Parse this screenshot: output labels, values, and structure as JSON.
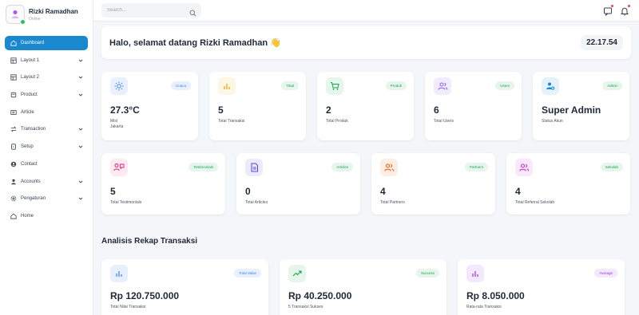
{
  "profile": {
    "name": "Rizki Ramadhan",
    "role": "Online",
    "avatar_icon": "user-logo-icon",
    "status_color": "#22c55e"
  },
  "sidebar": {
    "items": [
      {
        "label": "Dashboard",
        "icon": "home-icon",
        "active": true,
        "chevron": false
      },
      {
        "label": "Layout 1",
        "icon": "layout-icon",
        "active": false,
        "chevron": true
      },
      {
        "label": "Layout 2",
        "icon": "layout-icon",
        "active": false,
        "chevron": true
      },
      {
        "label": "Product",
        "icon": "box-icon",
        "active": false,
        "chevron": true
      },
      {
        "label": "Article",
        "icon": "article-icon",
        "active": false,
        "chevron": false
      },
      {
        "label": "Transaction",
        "icon": "transfer-icon",
        "active": false,
        "chevron": true
      },
      {
        "label": "Setup",
        "icon": "setup-icon",
        "active": false,
        "chevron": true
      },
      {
        "label": "Contact",
        "icon": "contact-icon",
        "active": false,
        "chevron": false
      },
      {
        "label": "Accounts",
        "icon": "user-icon",
        "active": false,
        "chevron": true
      },
      {
        "label": "Pengaturan",
        "icon": "gear-icon",
        "active": false,
        "chevron": true
      },
      {
        "label": "Home",
        "icon": "house-icon",
        "active": false,
        "chevron": false
      }
    ],
    "active_color": "#1a88cf"
  },
  "topbar": {
    "search_placeholder": "Search..."
  },
  "welcome": {
    "greeting": "Halo, selamat datang Rizki Ramadhan 👋",
    "time": "22.17.54"
  },
  "stats_row1": [
    {
      "value": "27.3°C",
      "label": "Mist",
      "label2": "Jakarta",
      "badge": "Cuaca",
      "icon": "sun-icon",
      "color": "#3b82f6",
      "bg": "#e8f0fe"
    },
    {
      "value": "5",
      "label": "Total Transaksi",
      "badge": "Total",
      "icon": "bar-chart-icon",
      "color": "#f59e0b",
      "bg": "#fef6e4"
    },
    {
      "value": "2",
      "label": "Total Produk",
      "badge": "Produk",
      "icon": "cart-icon",
      "color": "#16a34a",
      "bg": "#e7f6ec"
    },
    {
      "value": "6",
      "label": "Total Users",
      "badge": "Users",
      "icon": "users-icon",
      "color": "#8b5cf6",
      "bg": "#f1ecfd"
    },
    {
      "value": "Super Admin",
      "label": "Status Akun",
      "badge": "Admin",
      "icon": "user-gear-icon",
      "color": "#1a88cf",
      "bg": "#e6f2fa",
      "badge_color": "#16a34a",
      "badge_bg": "#e7f6ec"
    }
  ],
  "stats_row2": [
    {
      "value": "5",
      "label": "Total Testimonials",
      "badge": "Testimonials",
      "icon": "testimonial-icon",
      "color": "#db2777",
      "bg": "#fdeaf3",
      "badge_color": "#16a34a",
      "badge_bg": "#e7f6ec"
    },
    {
      "value": "0",
      "label": "Total Articles",
      "badge": "Articles",
      "icon": "document-icon",
      "color": "#4f46e5",
      "bg": "#eceafd",
      "badge_color": "#16a34a",
      "badge_bg": "#e7f6ec"
    },
    {
      "value": "4",
      "label": "Total Partners",
      "badge": "Partners",
      "icon": "partners-icon",
      "color": "#ea580c",
      "bg": "#fdeee4",
      "badge_color": "#16a34a",
      "badge_bg": "#e7f6ec"
    },
    {
      "value": "4",
      "label": "Total Referral Sekolah",
      "badge": "Sekolah",
      "icon": "school-icon",
      "color": "#c026d3",
      "bg": "#f9e9fb",
      "badge_color": "#16a34a",
      "badge_bg": "#e7f6ec"
    }
  ],
  "section": {
    "title": "Analisis Rekap Transaksi"
  },
  "summary": [
    {
      "value": "Rp 120.750.000",
      "label": "Total Nilai Transaksi",
      "badge": "Total Value",
      "icon": "bar-chart-icon",
      "color": "#3b82f6",
      "bg": "#e8f0fe",
      "badge_color": "#3b82f6",
      "badge_bg": "#e8f0fe"
    },
    {
      "value": "Rp 40.250.000",
      "label": "5 Transaksi Sukses",
      "badge": "Success",
      "icon": "trending-up-icon",
      "color": "#16a34a",
      "bg": "#e7f6ec",
      "badge_color": "#16a34a",
      "badge_bg": "#e7f6ec"
    },
    {
      "value": "Rp 8.050.000",
      "label": "Rata-rata Transaksi",
      "badge": "Average",
      "icon": "bar-chart-icon",
      "color": "#9333ea",
      "bg": "#f3e8fd",
      "badge_color": "#9333ea",
      "badge_bg": "#f3e8fd"
    }
  ]
}
